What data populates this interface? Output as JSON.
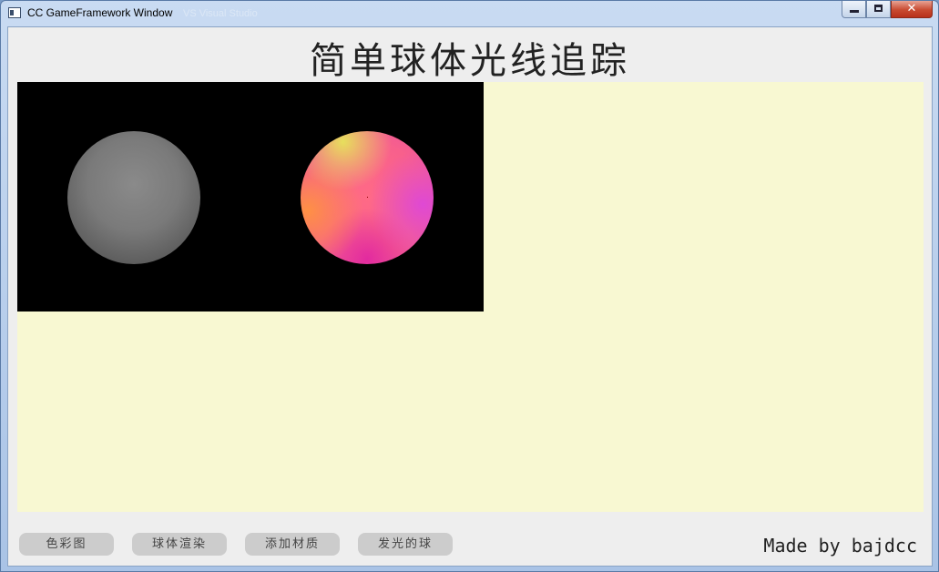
{
  "window": {
    "title": "CC GameFramework Window",
    "ghost_title": "VS Visual Studio",
    "controls": {
      "close_glyph": "✕"
    }
  },
  "heading": "简单球体光线追踪",
  "buttons": [
    "色彩图",
    "球体渲染",
    "添加材质",
    "发光的球"
  ],
  "credit": "Made by bajdcc",
  "colors": {
    "canvas_background": "#f8f8d2",
    "render_background": "#000000",
    "button_background": "#cccccc"
  }
}
